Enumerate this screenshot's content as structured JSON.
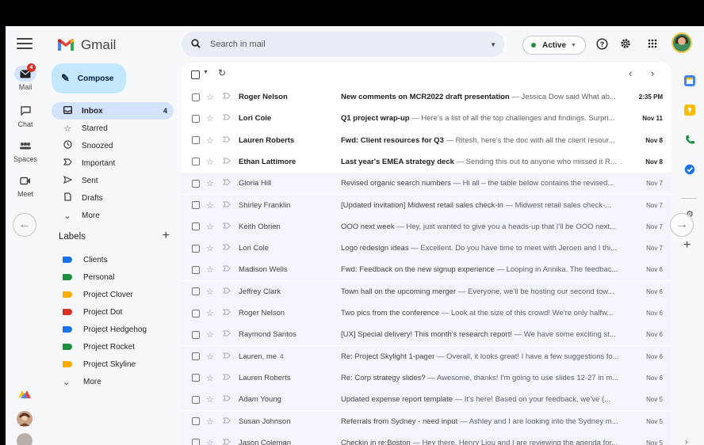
{
  "app": {
    "name": "Gmail"
  },
  "rail": {
    "items": [
      {
        "label": "Mail",
        "icon": "mail-icon",
        "badge": "4"
      },
      {
        "label": "Chat",
        "icon": "chat-icon"
      },
      {
        "label": "Spaces",
        "icon": "spaces-icon"
      },
      {
        "label": "Meet",
        "icon": "meet-icon"
      }
    ]
  },
  "compose": {
    "label": "Compose"
  },
  "nav": [
    {
      "label": "Inbox",
      "icon": "inbox-icon",
      "count": "4"
    },
    {
      "label": "Starred",
      "icon": "star-icon"
    },
    {
      "label": "Snoozed",
      "icon": "clock-icon"
    },
    {
      "label": "Important",
      "icon": "important-icon"
    },
    {
      "label": "Sent",
      "icon": "send-icon"
    },
    {
      "label": "Drafts",
      "icon": "draft-icon"
    },
    {
      "label": "More",
      "icon": "chevron-down-icon"
    }
  ],
  "labels": {
    "title": "Labels",
    "items": [
      {
        "label": "Clients",
        "color": "#1a73e8"
      },
      {
        "label": "Personal",
        "color": "#1e8e3e"
      },
      {
        "label": "Project Clover",
        "color": "#f9ab00"
      },
      {
        "label": "Project Dot",
        "color": "#d93025"
      },
      {
        "label": "Project Hedgehog",
        "color": "#1a73e8"
      },
      {
        "label": "Project Rocket",
        "color": "#1e8e3e"
      },
      {
        "label": "Project Skyline",
        "color": "#f9ab00"
      }
    ],
    "more": "More"
  },
  "search": {
    "placeholder": "Search in mail"
  },
  "status": {
    "label": "Active"
  },
  "emails": [
    {
      "sender": "Roger Nelson",
      "count": "",
      "subject": "New comments on MCR2022 draft presentation",
      "snippet": " — Jessica Dow said What ab...",
      "date": "2:35 PM",
      "unread": true
    },
    {
      "sender": "Lori Cole",
      "count": "",
      "subject": "Q1 project wrap-up",
      "snippet": " — Here's a list of all the top challenges and findings. Surpri...",
      "date": "Nov 11",
      "unread": true
    },
    {
      "sender": "Lauren Roberts",
      "count": "",
      "subject": "Fwd: Client resources for Q3",
      "snippet": " — Ritesh, here's the doc with all the client resour...",
      "date": "Nov 8",
      "unread": true
    },
    {
      "sender": "Ethan Lattimore",
      "count": "",
      "subject": "Last year's EMEA strategy deck",
      "snippet": " — Sending this out to anyone who missed it R...",
      "date": "Nov 8",
      "unread": true
    },
    {
      "sender": "Gloria Hill",
      "count": "",
      "subject": "Revised organic search numbers",
      "snippet": " — Hi all – the table below contains the revised...",
      "date": "Nov 7",
      "unread": false
    },
    {
      "sender": "Shirley Franklin",
      "count": "",
      "subject": "[Updated invitation] Midwest retail sales check-in",
      "snippet": " — Midwest retail sales check-...",
      "date": "Nov 7",
      "unread": false
    },
    {
      "sender": "Keith Obrien",
      "count": "",
      "subject": "OOO next week",
      "snippet": " — Hey, just wanted to give you a heads-up that I'll be OOO next...",
      "date": "Nov 7",
      "unread": false
    },
    {
      "sender": "Lori Cole",
      "count": "",
      "subject": "Logo redesign ideas",
      "snippet": " — Excellent. Do you have time to meet with Jeroen and I thi...",
      "date": "Nov 7",
      "unread": false
    },
    {
      "sender": "Madison Wells",
      "count": "",
      "subject": "Fwd: Feedback on the new signup experience",
      "snippet": " — Looping in Annika. The feedbac...",
      "date": "Nov 6",
      "unread": false
    },
    {
      "sender": "Jeffrey Clark",
      "count": "",
      "subject": "Town hall on the upcoming merger",
      "snippet": " — Everyone, we'll be hosting our second tow...",
      "date": "Nov 6",
      "unread": false
    },
    {
      "sender": "Roger Nelson",
      "count": "",
      "subject": "Two pics from the conference",
      "snippet": " — Look at the size of this crowd! We're only halfw...",
      "date": "Nov 6",
      "unread": false
    },
    {
      "sender": "Raymond Santos",
      "count": "",
      "subject": "[UX] Special delivery! This month's research report!",
      "snippet": " — We have some exciting st...",
      "date": "Nov 6",
      "unread": false
    },
    {
      "sender": "Lauren, me",
      "count": "4",
      "subject": "Re: Project Skylight 1-pager",
      "snippet": " — Overall, it looks great! I have a few suggestions fo...",
      "date": "Nov 6",
      "unread": false
    },
    {
      "sender": "Lauren Roberts",
      "count": "",
      "subject": "Re: Corp strategy slides?",
      "snippet": " — Awesome, thanks! I'm going to use slides 12-27 in m...",
      "date": "Nov 6",
      "unread": false
    },
    {
      "sender": "Adam Young",
      "count": "",
      "subject": "Updated expense report template",
      "snippet": " — It's here! Based on your feedback, we've (...",
      "date": "Nov 5",
      "unread": false
    },
    {
      "sender": "Susan Johnson",
      "count": "",
      "subject": "Referrals from Sydney - need input",
      "snippet": " — Ashley and I are looking into the Sydney m...",
      "date": "Nov 5",
      "unread": false
    },
    {
      "sender": "Jason Coleman",
      "count": "",
      "subject": "Checkin in re:Boston",
      "snippet": " — Hey there. Henry Liou and I are reviewing the agenda for...",
      "date": "Nov 5",
      "unread": false
    }
  ],
  "colors": {
    "accent": "#c2e7ff",
    "nav_active": "#d3e3fd",
    "read_row": "#f2f6fc",
    "background": "#f6f8fc"
  }
}
